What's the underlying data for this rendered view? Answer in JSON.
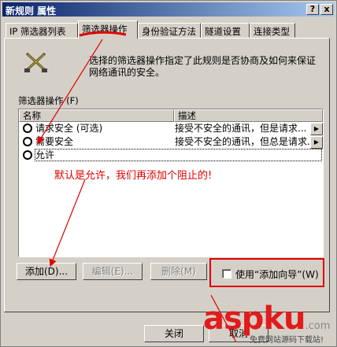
{
  "window": {
    "title": "新规则 属性",
    "help_btn": "?",
    "close_btn": "x"
  },
  "tabs": [
    {
      "label": "IP 筛选器列表"
    },
    {
      "label": "筛选器操作",
      "active": true
    },
    {
      "label": "身份验证方法"
    },
    {
      "label": "隧道设置"
    },
    {
      "label": "连接类型"
    }
  ],
  "page": {
    "icon": "filter-action-icon",
    "description_line1": "选择的筛选器操作指定了此规则是否协商及如何来保证",
    "description_line2": "网络通讯的安全。",
    "group_label": "筛选器操作 (F)",
    "columns": [
      "名称",
      "描述"
    ],
    "rows": [
      {
        "name": "请求安全 (可选)",
        "desc": "接受不安全的通讯，但是请求...",
        "selected": false
      },
      {
        "name": "需要安全",
        "desc": "接受不安全的通讯，但总是请求...",
        "selected": false
      },
      {
        "name": "允许",
        "desc": "",
        "selected": true,
        "focused": true
      }
    ],
    "buttons": {
      "add": "添加(D)...",
      "edit": "编辑(E)...",
      "remove": "删除(M)"
    },
    "wizard": {
      "label": "使用“添加向导”(W)",
      "checked": false
    }
  },
  "annotation": "默认是允许，我们再添加个阻止的!",
  "footer": {
    "close": "关闭",
    "cancel": "取消"
  },
  "watermark": {
    "brand": "aspku",
    "suffix": ".com",
    "tagline": "免费网站源码下载站!"
  },
  "colors": {
    "annotation": "#e00000",
    "title_bar_start": "#0a246a",
    "title_bar_end": "#a6caf0",
    "face": "#d4d0c8"
  }
}
